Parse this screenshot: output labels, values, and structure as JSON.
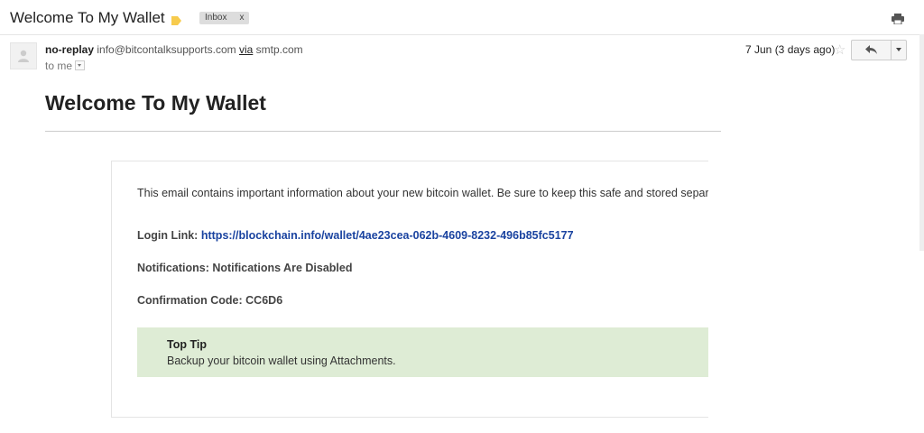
{
  "header": {
    "subject": "Welcome To My Wallet",
    "label_icon": "label-tag-icon",
    "label_color": "#f7cb4d",
    "chip_label": "Inbox",
    "chip_close": "x",
    "print_icon": "print-icon"
  },
  "message": {
    "sender_name": "no-replay",
    "sender_email": "info@bitcontalksupports.com",
    "via_label": "via",
    "via_domain": "smtp.com",
    "to_label": "to me",
    "date": "7 Jun (3 days ago)",
    "star_glyph": "☆"
  },
  "body": {
    "heading": "Welcome To My Wallet",
    "intro": "This email contains important information about your new bitcoin wallet. Be sure to keep this safe and stored separa",
    "login_label": "Login Link:",
    "login_url": "https://blockchain.info/wallet/4ae23cea-062b-4609-8232-496b85fc5177",
    "notifications_label": "Notifications:",
    "notifications_value": "Notifications Are Disabled",
    "confirmation_label": "Confirmation Code:",
    "confirmation_value": "CC6D6",
    "tip_title": "Top Tip",
    "tip_text": "Backup your bitcoin wallet using Attachments.",
    "tip_bg": "#deecd5",
    "link_color": "#1a43a0"
  }
}
